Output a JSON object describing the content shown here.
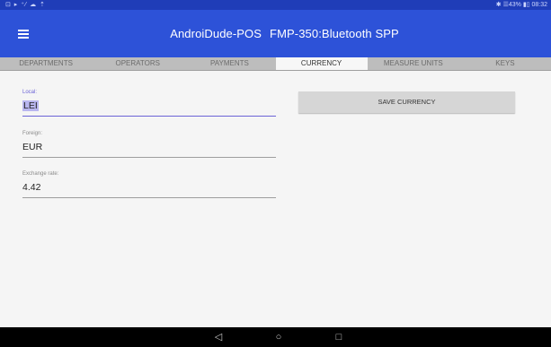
{
  "statusbar": {
    "left_icons": "⊡ ▸ ⁺⁄ ☁ ⇡",
    "right_text": "✱ ☰43% ▮▯ 08:32"
  },
  "appbar": {
    "title": "AndroiDude-POS",
    "subtitle": "FMP-350:Bluetooth SPP",
    "menu_icon": "hamburger-icon"
  },
  "tabs": [
    {
      "label": "DEPARTMENTS",
      "active": false
    },
    {
      "label": "OPERATORS",
      "active": false
    },
    {
      "label": "PAYMENTS",
      "active": false
    },
    {
      "label": "CURRENCY",
      "active": true
    },
    {
      "label": "MEASURE UNITS",
      "active": false
    },
    {
      "label": "KEYS",
      "active": false
    }
  ],
  "form": {
    "local": {
      "label": "Local:",
      "value": "LEI"
    },
    "foreign": {
      "label": "Foreign:",
      "value": "EUR"
    },
    "exchange_rate": {
      "label": "Exchange rate:",
      "value": "4.42"
    }
  },
  "save_button": {
    "label": "SAVE CURRENCY"
  },
  "colors": {
    "statusbar": "#1f3db8",
    "appbar": "#2d52d8",
    "accent": "#6b63d6"
  }
}
